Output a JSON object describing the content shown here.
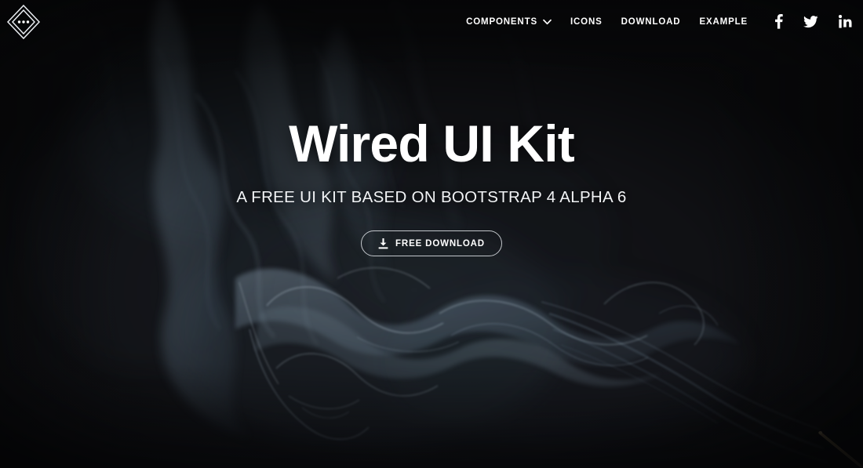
{
  "brand": {
    "logo_icon": "diamond-dots-logo",
    "shape": "double-diamond-outline-with-three-dots"
  },
  "nav": {
    "items": [
      {
        "label": "COMPONENTS",
        "has_dropdown": true,
        "icon": "chevron-down-icon"
      },
      {
        "label": "ICONS",
        "has_dropdown": false
      },
      {
        "label": "DOWNLOAD",
        "has_dropdown": false
      },
      {
        "label": "EXAMPLE",
        "has_dropdown": false
      }
    ],
    "social": [
      {
        "name": "facebook-icon",
        "label": "Facebook"
      },
      {
        "name": "twitter-icon",
        "label": "Twitter"
      },
      {
        "name": "linkedin-icon",
        "label": "LinkedIn"
      }
    ]
  },
  "hero": {
    "title": "Wired UI Kit",
    "subtitle": "A FREE UI KIT BASED ON BOOTSTRAP 4 ALPHA 6",
    "cta": {
      "label": "FREE DOWNLOAD",
      "icon": "download-icon"
    },
    "background": "dark-smoke-photograph"
  },
  "colors": {
    "background": "#141519",
    "text_primary": "#ffffff",
    "text_secondary": "#f2f4f6",
    "smoke": "#8fa8bd",
    "incense_stick": "#b39a6b",
    "button_border": "#e8ecf0"
  }
}
